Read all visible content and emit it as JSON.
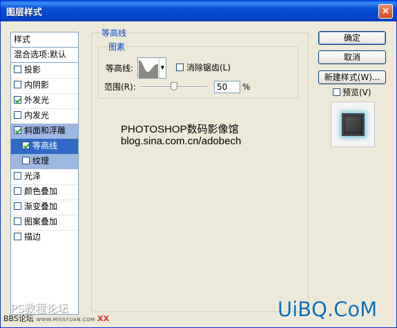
{
  "window": {
    "title": "图层样式",
    "close": "×"
  },
  "styles_panel": {
    "header": "样式",
    "blend_default": "混合选项:默认",
    "items": [
      {
        "label": "投影",
        "checked": false
      },
      {
        "label": "内阴影",
        "checked": false
      },
      {
        "label": "外发光",
        "checked": true
      },
      {
        "label": "内发光",
        "checked": false
      },
      {
        "label": "斜面和浮雕",
        "checked": true
      },
      {
        "label": "等高线",
        "checked": true
      },
      {
        "label": "纹理",
        "checked": false
      },
      {
        "label": "光泽",
        "checked": false
      },
      {
        "label": "颜色叠加",
        "checked": false
      },
      {
        "label": "渐变叠加",
        "checked": false
      },
      {
        "label": "图案叠加",
        "checked": false
      },
      {
        "label": "描边",
        "checked": false
      }
    ]
  },
  "contour_section": {
    "group_title": "等高线",
    "sub_group_title": "图素",
    "contour_label": "等高线:",
    "antialias_label": "消除锯齿(L)",
    "antialias_checked": false,
    "range_label": "范围(R):",
    "range_value": "50",
    "range_unit": "%",
    "range_fraction": 0.5
  },
  "buttons": {
    "ok": "确定",
    "cancel": "取消",
    "new_style": "新建样式(W)...",
    "preview_label": "预览(V)",
    "preview_checked": false
  },
  "overlay_text": {
    "line1": "PHOTOSHOP数码影像馆",
    "line2": "blog.sina.com.cn/adobech"
  },
  "watermarks": {
    "ps_forum": "PS教程论坛",
    "bbs_prefix": "BBS论坛",
    "bbs_url": "WWW.MISSYUAN.COM",
    "bbs_xx": "XX",
    "logo": "UiBQ.CoM"
  },
  "colors": {
    "title_blue": "#0a52d8",
    "selected_blue": "#316ac5",
    "light_selection": "#9fb8e2",
    "group_title": "#0046d5",
    "glow_cyan": "#7fcfe6",
    "logo_blue": "#0b6fb9"
  }
}
